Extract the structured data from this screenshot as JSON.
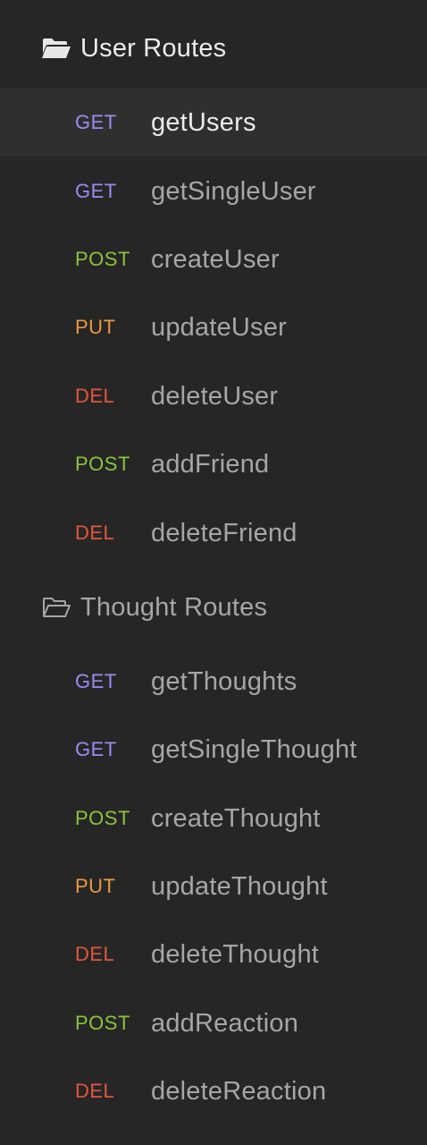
{
  "colors": {
    "GET": "#9b8cf2",
    "POST": "#8ac43b",
    "PUT": "#eb9a3e",
    "DEL": "#e2573c"
  },
  "folders": [
    {
      "label": "User Routes",
      "icon": "folder-open-icon",
      "state": "open",
      "requests": [
        {
          "method": "GET",
          "name": "getUsers",
          "active": true
        },
        {
          "method": "GET",
          "name": "getSingleUser",
          "active": false
        },
        {
          "method": "POST",
          "name": "createUser",
          "active": false
        },
        {
          "method": "PUT",
          "name": "updateUser",
          "active": false
        },
        {
          "method": "DEL",
          "name": "deleteUser",
          "active": false
        },
        {
          "method": "POST",
          "name": "addFriend",
          "active": false
        },
        {
          "method": "DEL",
          "name": "deleteFriend",
          "active": false
        }
      ]
    },
    {
      "label": "Thought Routes",
      "icon": "folder-outline-icon",
      "state": "closed",
      "requests": [
        {
          "method": "GET",
          "name": "getThoughts",
          "active": false
        },
        {
          "method": "GET",
          "name": "getSingleThought",
          "active": false
        },
        {
          "method": "POST",
          "name": "createThought",
          "active": false
        },
        {
          "method": "PUT",
          "name": "updateThought",
          "active": false
        },
        {
          "method": "DEL",
          "name": "deleteThought",
          "active": false
        },
        {
          "method": "POST",
          "name": "addReaction",
          "active": false
        },
        {
          "method": "DEL",
          "name": "deleteReaction",
          "active": false
        }
      ]
    }
  ]
}
